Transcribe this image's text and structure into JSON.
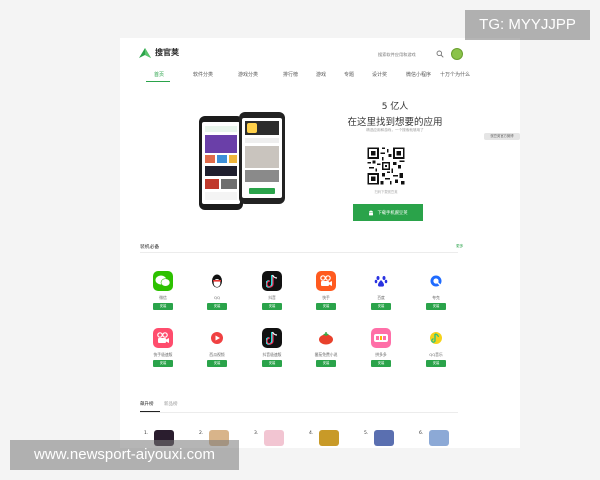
{
  "header": {
    "logo_text": "搜官荚",
    "search_placeholder": "搜索软件应用和游戏"
  },
  "nav": {
    "items": [
      {
        "label": "首页",
        "active": true
      },
      {
        "label": "软件分类",
        "active": false
      },
      {
        "label": "游戏分类",
        "active": false
      },
      {
        "label": "排行榜",
        "active": false
      },
      {
        "label": "游戏",
        "active": false
      },
      {
        "label": "专题",
        "active": false
      },
      {
        "label": "设计奖",
        "active": false
      },
      {
        "label": "微信小程序",
        "active": false
      },
      {
        "label": "十万个为什么",
        "active": false
      }
    ]
  },
  "hero": {
    "count": "5 亿人",
    "title": "在这里找到想要的应用",
    "subtitle": "精选应用和游戏，一个搜索就够用了",
    "qr_caption": "扫码下载豌豆荚",
    "cta_label": "下载手机豌豆荚",
    "side_badge": "豌豆荚官方微博"
  },
  "essentials": {
    "title": "装机必备",
    "more": "更多",
    "install_label": "安装",
    "apps": [
      {
        "name": "微信",
        "icon": "wechat-icon",
        "color": "#2dc100"
      },
      {
        "name": "QQ",
        "icon": "qq-penguin-icon",
        "color": "#ffffff"
      },
      {
        "name": "抖音",
        "icon": "douyin-icon",
        "color": "#111111"
      },
      {
        "name": "快手",
        "icon": "kuaishou-icon",
        "color": "#ff5a1f"
      },
      {
        "name": "百度",
        "icon": "baidu-paw-icon",
        "color": "#ffffff"
      },
      {
        "name": "夸克",
        "icon": "quark-icon",
        "color": "#ffffff"
      },
      {
        "name": "快手极速版",
        "icon": "kuaishou-lite-icon",
        "color": "#ff4d6d"
      },
      {
        "name": "西瓜视频",
        "icon": "xigua-icon",
        "color": "#ffffff"
      },
      {
        "name": "抖音极速版",
        "icon": "douyin-lite-icon",
        "color": "#111111"
      },
      {
        "name": "番茄免费小说",
        "icon": "fanqie-icon",
        "color": "#ffffff"
      },
      {
        "name": "拼多多",
        "icon": "pinduoduo-icon",
        "color": "#ff6fa8"
      },
      {
        "name": "QQ音乐",
        "icon": "qqmusic-icon",
        "color": "#ffffff"
      }
    ]
  },
  "ranking": {
    "tabs": [
      {
        "label": "飙升榜",
        "active": true
      },
      {
        "label": "新品榜",
        "active": false
      }
    ],
    "items": [
      {
        "rank": "1.",
        "color": "#2a1d2e"
      },
      {
        "rank": "2.",
        "color": "#d8b48a"
      },
      {
        "rank": "3.",
        "color": "#f2c5d2"
      },
      {
        "rank": "4.",
        "color": "#c89a28"
      },
      {
        "rank": "5.",
        "color": "#5a6fb0"
      },
      {
        "rank": "6.",
        "color": "#8ca9d6"
      }
    ]
  },
  "watermarks": {
    "tg": "TG: MYYJJPP",
    "site": "www.newsport-aiyouxi.com"
  },
  "colors": {
    "brand_green": "#2aa34a",
    "page_bg": "#f4f4f4"
  }
}
